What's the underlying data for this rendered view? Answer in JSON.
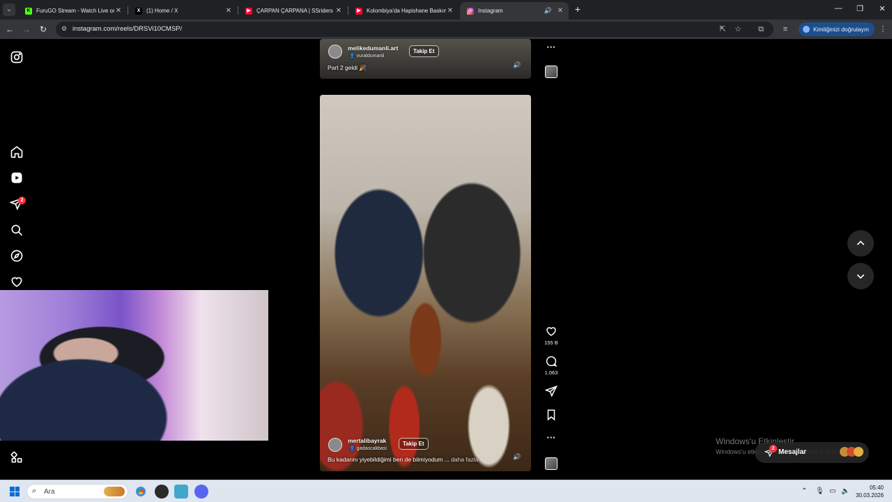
{
  "browser": {
    "tabs": [
      {
        "title": "FuruGO Stream - Watch Live on",
        "favicon": "kick-icon",
        "color": "#53fc18"
      },
      {
        "title": "(1) Home / X",
        "favicon": "x-icon",
        "color": "#ffffff"
      },
      {
        "title": "ÇARPAN ÇARPANA | SSriders | Y",
        "favicon": "youtube-icon",
        "color": "#ff0033"
      },
      {
        "title": "Kolombiya'da Hapishane Baskın",
        "favicon": "youtube-icon",
        "color": "#ff0033"
      },
      {
        "title": "Instagram",
        "favicon": "instagram-icon",
        "color": "#e1306c",
        "active": true
      }
    ],
    "url": "instagram.com/reels/DRSVi10CMSP/",
    "verify_label": "Kimliğinizi doğrulayın"
  },
  "sidebar": {
    "items": [
      "instagram-logo-icon",
      "home-icon",
      "reels-icon",
      "messages-icon",
      "search-icon",
      "explore-icon",
      "notifications-icon",
      "more-icon"
    ],
    "messages_badge": "2"
  },
  "reels": [
    {
      "username": "melikedumanli.art",
      "audio": "vuraldumanli",
      "follow_label": "Takip Et",
      "caption": "Part 2 geldi 🎉"
    },
    {
      "username": "mertalibayrak",
      "audio": "gadaocakbasi",
      "follow_label": "Takip Et",
      "caption": "Bu kadarını yiyebildiğimi ben de bilmiyodum ...",
      "more_label": "daha fazla",
      "likes": "155 B",
      "comments": "1.063"
    }
  ],
  "watermark": {
    "title": "Windows'u Etkinleştir",
    "subtitle": "Windows'u etkinleştirmek için Ayarlar'a gidin."
  },
  "messages_pill": {
    "label": "Mesajlar",
    "badge": "2"
  },
  "taskbar": {
    "search_placeholder": "Ara",
    "time": "05:40",
    "date": "30.03.2026"
  },
  "colors": {
    "accent": "#0095f6",
    "badge": "#ff3040",
    "background": "#000000"
  }
}
